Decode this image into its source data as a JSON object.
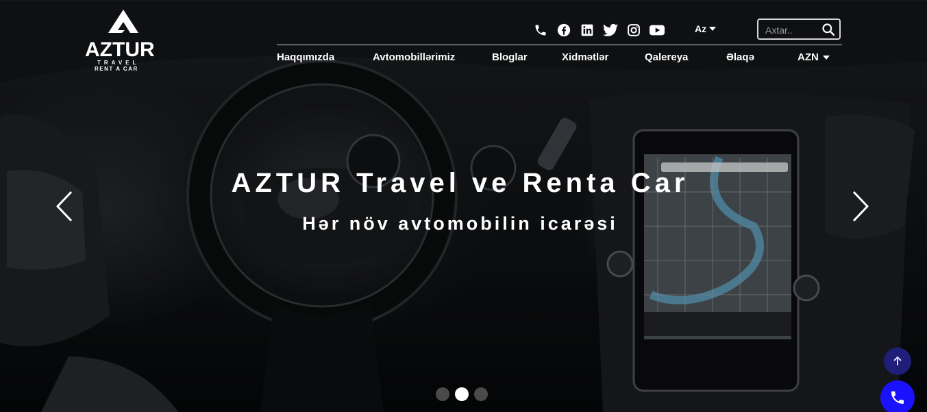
{
  "brand": {
    "name": "AZTUR",
    "line1": "TRAVEL",
    "line2": "RENT A CAR"
  },
  "social_icons": [
    "phone-icon",
    "facebook-icon",
    "linkedin-icon",
    "twitter-icon",
    "instagram-icon",
    "youtube-icon"
  ],
  "language": {
    "selected": "Az"
  },
  "search": {
    "placeholder": "Axtar.."
  },
  "nav": {
    "items": [
      "Haqqımızda",
      "Avtomobillərimiz",
      "Bloglar",
      "Xidmətlər",
      "Qalereya",
      "Əlaqə"
    ],
    "currency": "AZN"
  },
  "hero": {
    "title": "AZTUR Travel ve Renta Car",
    "subtitle": "Hər növ avtomobilin icarəsi",
    "active_slide": 2,
    "slide_count": 3
  },
  "colors": {
    "accent_call": "#1a12ff",
    "scroll_top": "#1f1f7a",
    "text": "#ffffff"
  }
}
